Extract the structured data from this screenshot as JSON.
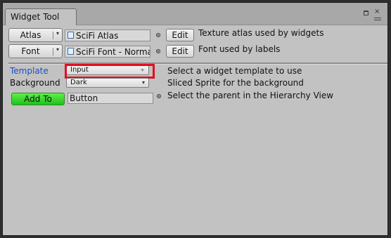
{
  "window": {
    "tab_title": "Widget Tool",
    "close_glyph": "×"
  },
  "rows": {
    "atlas": {
      "button_label": "Atlas",
      "field_value": "SciFi Atlas",
      "edit_label": "Edit",
      "description": "Texture atlas used by widgets"
    },
    "font": {
      "button_label": "Font",
      "field_value": "SciFi Font - Normal",
      "edit_label": "Edit",
      "description": "Font used by labels"
    }
  },
  "properties": {
    "template": {
      "label": "Template",
      "selected": "Input",
      "arrow": "÷",
      "description": "Select a widget template to use"
    },
    "background": {
      "label": "Background",
      "selected": "Dark",
      "arrow": "▾",
      "description": "Sliced Sprite for the background"
    },
    "add_to": {
      "button_label": "Add To",
      "field_value": "Button",
      "description": "Select the parent in the Hierarchy View"
    }
  },
  "colors": {
    "highlight": "#e01020",
    "add_to_button": "#2ed628",
    "template_label": "#1a4fc7",
    "panel_bg": "#c2c2c2"
  },
  "icons": {
    "dropdown": "▾",
    "object_field": "sprite-asset-icon",
    "picker": "object-picker-icon"
  }
}
